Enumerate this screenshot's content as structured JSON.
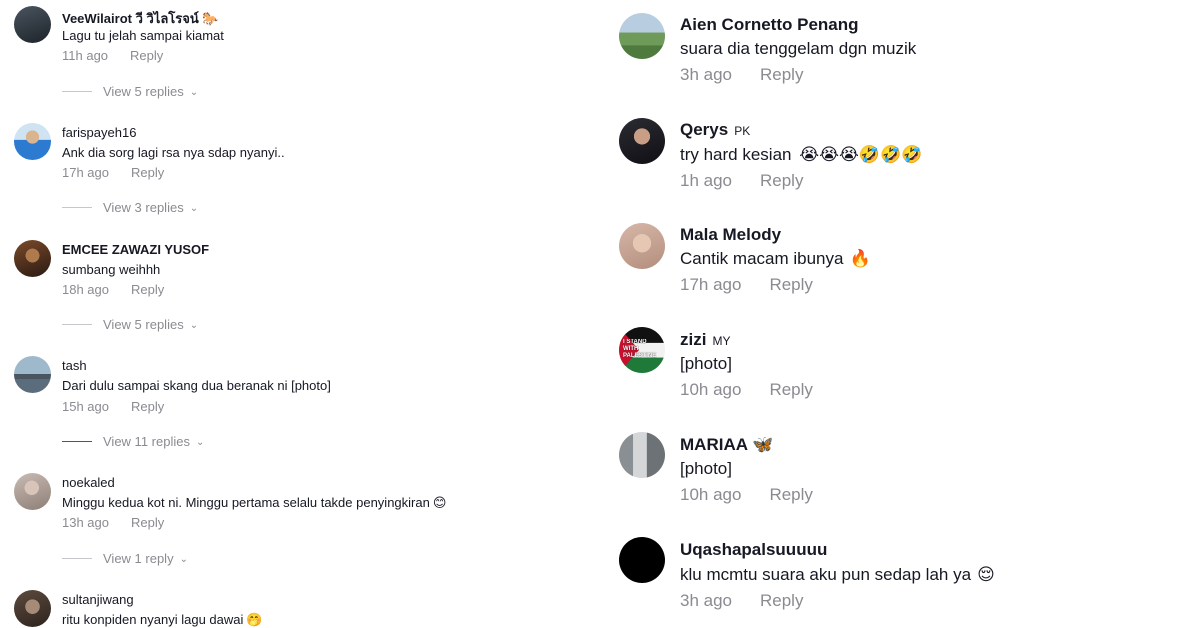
{
  "left": {
    "comments": [
      {
        "user": "VeeWilairot วี วิไลโรจน์ 🐎",
        "text": "Lagu tu jelah sampai kiamat",
        "time": "11h ago",
        "reply": "Reply",
        "replies": "View 5 replies"
      },
      {
        "user": "farispayeh16",
        "text": "Ank dia sorg lagi rsa nya sdap nyanyi..",
        "time": "17h ago",
        "reply": "Reply",
        "replies": "View 3 replies"
      },
      {
        "user": "EMCEE ZAWAZI YUSOF",
        "text": "sumbang weihhh",
        "time": "18h ago",
        "reply": "Reply",
        "replies": "View 5 replies"
      },
      {
        "user": "tash",
        "text": "Dari dulu sampai skang dua beranak ni [photo]",
        "time": "15h ago",
        "reply": "Reply",
        "replies": "View 11 replies"
      },
      {
        "user": "noekaled",
        "text": "Minggu kedua kot ni. Minggu pertama selalu takde penyingkiran",
        "emoji": "😊",
        "time": "13h ago",
        "reply": "Reply",
        "replies": "View 1 reply"
      },
      {
        "user": "sultanjiwang",
        "text": "ritu konpiden nyanyi lagu dawai",
        "emoji": "🤭",
        "time": "",
        "reply": "",
        "replies": ""
      }
    ]
  },
  "right": {
    "comments": [
      {
        "user": "Aien Cornetto Penang",
        "badge": "",
        "text": "suara dia tenggelam dgn muzik",
        "time": "3h ago",
        "reply": "Reply"
      },
      {
        "user": "Qerys",
        "badge": "PK",
        "text": "try hard kesian",
        "emoji": "😭😭😭🤣🤣🤣",
        "time": "1h ago",
        "reply": "Reply"
      },
      {
        "user": "Mala Melody",
        "badge": "",
        "text": "Cantik macam ibunya",
        "emoji": "🔥",
        "time": "17h ago",
        "reply": "Reply"
      },
      {
        "user": "zizi",
        "badge": "MY",
        "text": "[photo]",
        "time": "10h ago",
        "reply": "Reply"
      },
      {
        "user": "MARIAA 🦋",
        "badge": "",
        "text": "[photo]",
        "time": "10h ago",
        "reply": "Reply"
      },
      {
        "user": "Uqashapalsuuuuu",
        "badge": "",
        "text": "klu mcmtu suara aku pun sedap lah ya",
        "emoji": "😌",
        "time": "3h ago",
        "reply": "Reply"
      }
    ]
  },
  "avatar_text": "I STAND WITH PALESTINE"
}
